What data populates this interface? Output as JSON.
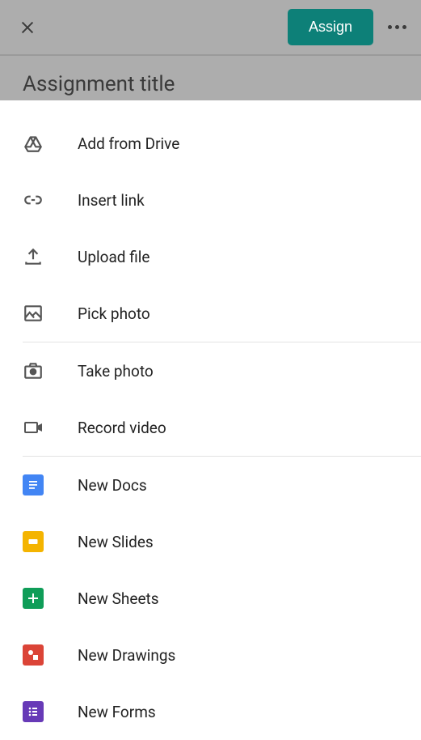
{
  "header": {
    "assign_button": "Assign",
    "title_placeholder": "Assignment title"
  },
  "menu": {
    "add_from_drive": "Add from Drive",
    "insert_link": "Insert link",
    "upload_file": "Upload file",
    "pick_photo": "Pick photo",
    "take_photo": "Take photo",
    "record_video": "Record video",
    "new_docs": "New Docs",
    "new_slides": "New Slides",
    "new_sheets": "New Sheets",
    "new_drawings": "New Drawings",
    "new_forms": "New Forms"
  }
}
